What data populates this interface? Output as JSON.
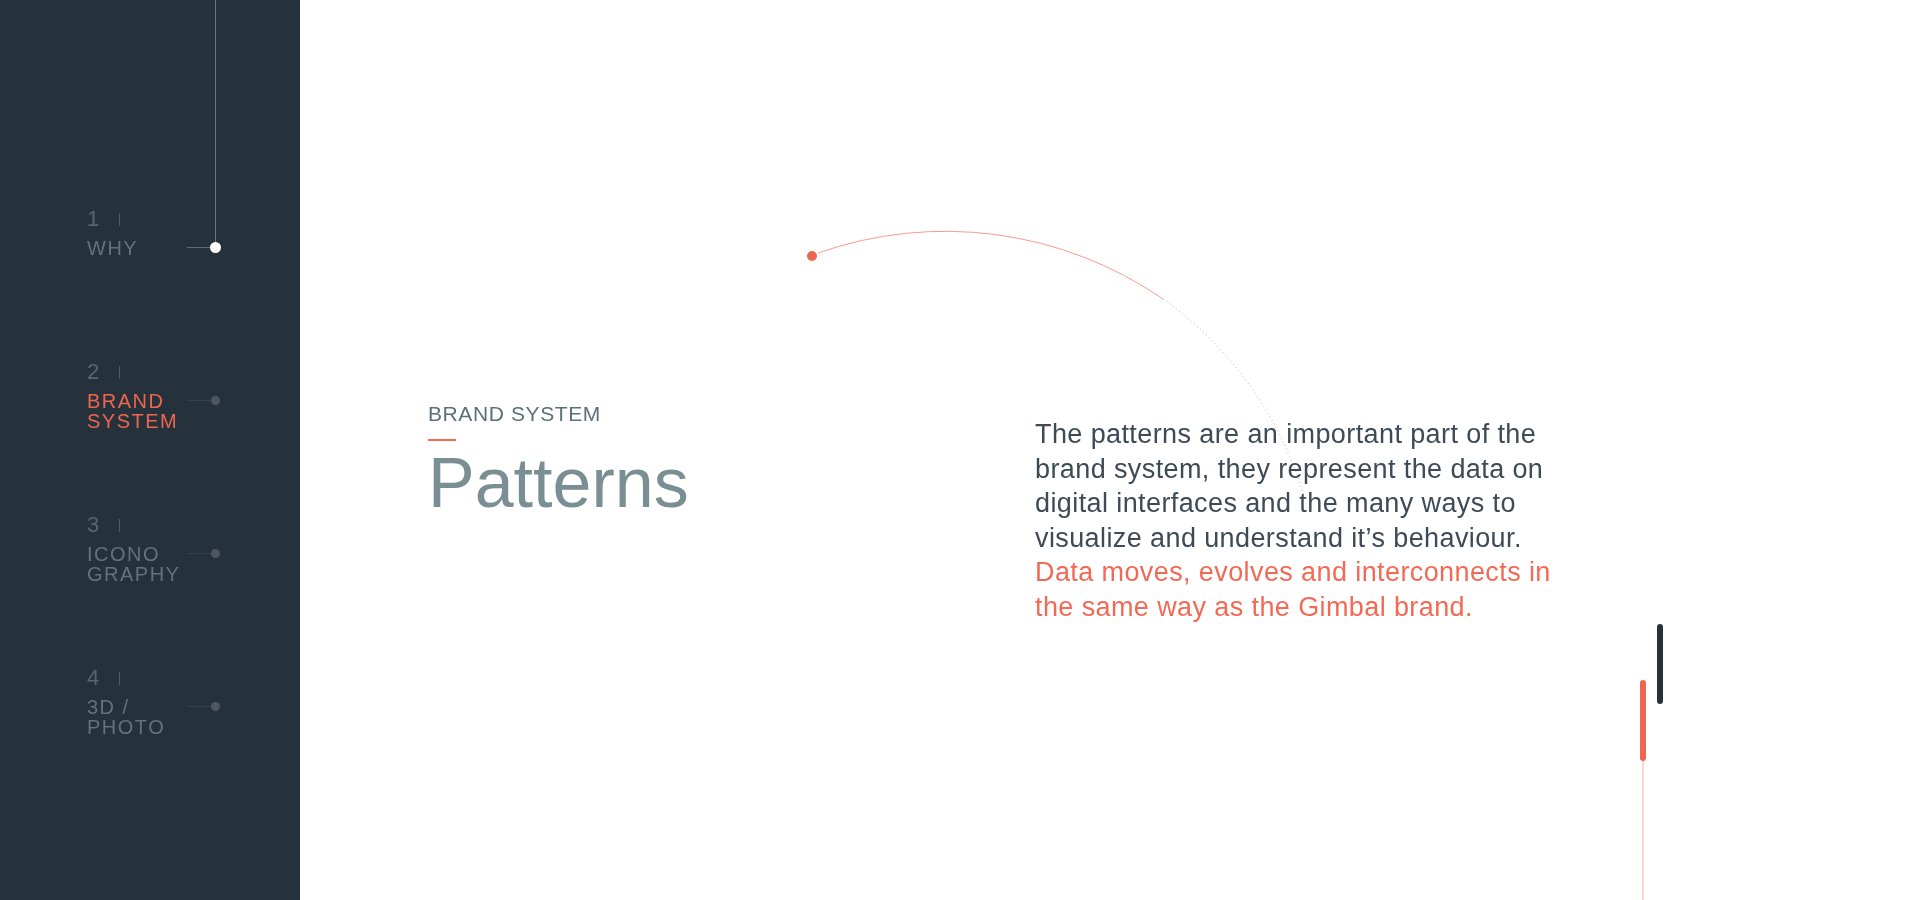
{
  "sidebar": {
    "items": [
      {
        "number": "1",
        "label": "WHY",
        "selected": false,
        "passed": true
      },
      {
        "number": "2",
        "label": "BRAND\nSYSTEM",
        "selected": true,
        "passed": false
      },
      {
        "number": "3",
        "label": "ICONO\nGRAPHY",
        "selected": false,
        "passed": false
      },
      {
        "number": "4",
        "label": "3D /\nPHOTO",
        "selected": false,
        "passed": false
      }
    ]
  },
  "section": {
    "eyebrow": "BRAND SYSTEM",
    "title": "Patterns"
  },
  "description": {
    "body": "The patterns are an important part of the brand system, they represent the data on digital interfaces and the many ways to visualize and understand it’s behaviour.",
    "highlight": "Data moves, evolves and interconnects in the same way as the Gimbal brand."
  }
}
